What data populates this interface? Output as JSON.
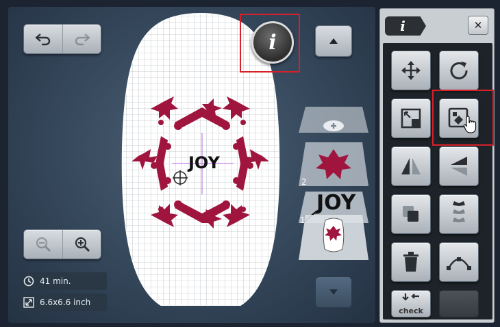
{
  "toolbar": {
    "undo_icon": "undo-icon",
    "redo_icon": "redo-icon"
  },
  "zoom": {
    "zoom_out_icon": "zoom-out-icon",
    "zoom_in_icon": "zoom-in-icon"
  },
  "info_button": {
    "label": "i"
  },
  "design": {
    "text": "JOY"
  },
  "layers": {
    "items": [
      {
        "number": "2"
      },
      {
        "number": "1"
      }
    ]
  },
  "status": {
    "time": "41 min.",
    "size": "6.6x6.6 inch"
  },
  "panel": {
    "tab_label": "i",
    "close_label": "✕",
    "check_label": "check"
  },
  "colors": {
    "design_red": "#a0153e",
    "highlight": "#d6202a"
  }
}
